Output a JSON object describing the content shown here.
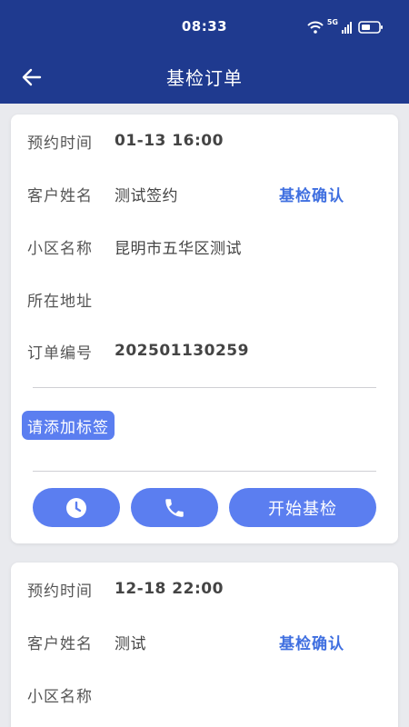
{
  "status_bar": {
    "time": "08:33",
    "network": "5G"
  },
  "header": {
    "title": "基检订单"
  },
  "orders": [
    {
      "time_label": "预约时间",
      "time_value": "01-13 16:00",
      "customer_label": "客户姓名",
      "customer_value": "测试签约",
      "confirm_link": "基检确认",
      "community_label": "小区名称",
      "community_value": "昆明市五华区测试",
      "address_label": "所在地址",
      "address_value": "",
      "order_no_label": "订单编号",
      "order_no_value": "202501130259",
      "tag_button": "请添加标签",
      "clock_icon": "clock-icon",
      "phone_icon": "phone-icon",
      "start_button": "开始基检"
    },
    {
      "time_label": "预约时间",
      "time_value": "12-18 22:00",
      "customer_label": "客户姓名",
      "customer_value": "测试",
      "confirm_link": "基检确认",
      "community_label": "小区名称",
      "community_value": ""
    }
  ],
  "colors": {
    "header_bg": "#1f3a8f",
    "accent": "#5b7ef0",
    "link": "#3f6fe0",
    "page_bg": "#e9eaee"
  }
}
